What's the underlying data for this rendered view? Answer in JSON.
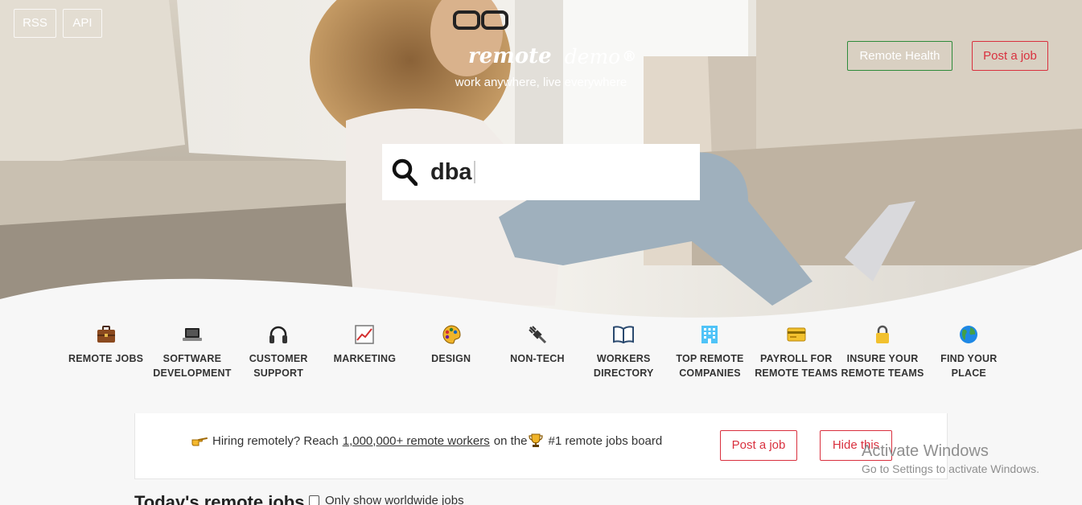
{
  "header": {
    "rss_label": "RSS",
    "api_label": "API",
    "logo_left": "remote",
    "logo_right": "demo",
    "logo_reg": "®",
    "tagline": "work anywhere, live everywhere",
    "remote_health_label": "Remote Health",
    "post_job_label": "Post a job"
  },
  "search": {
    "value": "dba",
    "icon": "search-icon"
  },
  "categories": [
    {
      "label": "REMOTE JOBS",
      "icon": "briefcase-icon"
    },
    {
      "label": "SOFTWARE DEVELOPMENT",
      "icon": "laptop-icon"
    },
    {
      "label": "CUSTOMER SUPPORT",
      "icon": "headphones-icon"
    },
    {
      "label": "MARKETING",
      "icon": "chart-icon"
    },
    {
      "label": "DESIGN",
      "icon": "palette-icon"
    },
    {
      "label": "NON-TECH",
      "icon": "plug-icon"
    },
    {
      "label": "WORKERS DIRECTORY",
      "icon": "book-icon"
    },
    {
      "label": "TOP REMOTE COMPANIES",
      "icon": "building-icon"
    },
    {
      "label": "PAYROLL FOR REMOTE TEAMS",
      "icon": "credit-card-icon"
    },
    {
      "label": "INSURE YOUR REMOTE TEAMS",
      "icon": "lock-icon"
    },
    {
      "label": "FIND YOUR PLACE",
      "icon": "globe-icon"
    }
  ],
  "banner": {
    "text_before": "Hiring remotely? Reach",
    "link_text": "1,000,000+ remote workers",
    "text_middle": "on the",
    "text_after": "#1 remote jobs board",
    "post_job_label": "Post a job",
    "hide_label": "Hide this"
  },
  "watermark": {
    "line1": "Activate Windows",
    "line2": "Go to Settings to activate Windows."
  },
  "jobs": {
    "heading": "Today's remote jobs",
    "worldwide_label": "Only show worldwide jobs"
  },
  "colors": {
    "accent_red": "#d9303e",
    "accent_green": "#2e8b3a",
    "page_bg": "#f7f7f7"
  }
}
